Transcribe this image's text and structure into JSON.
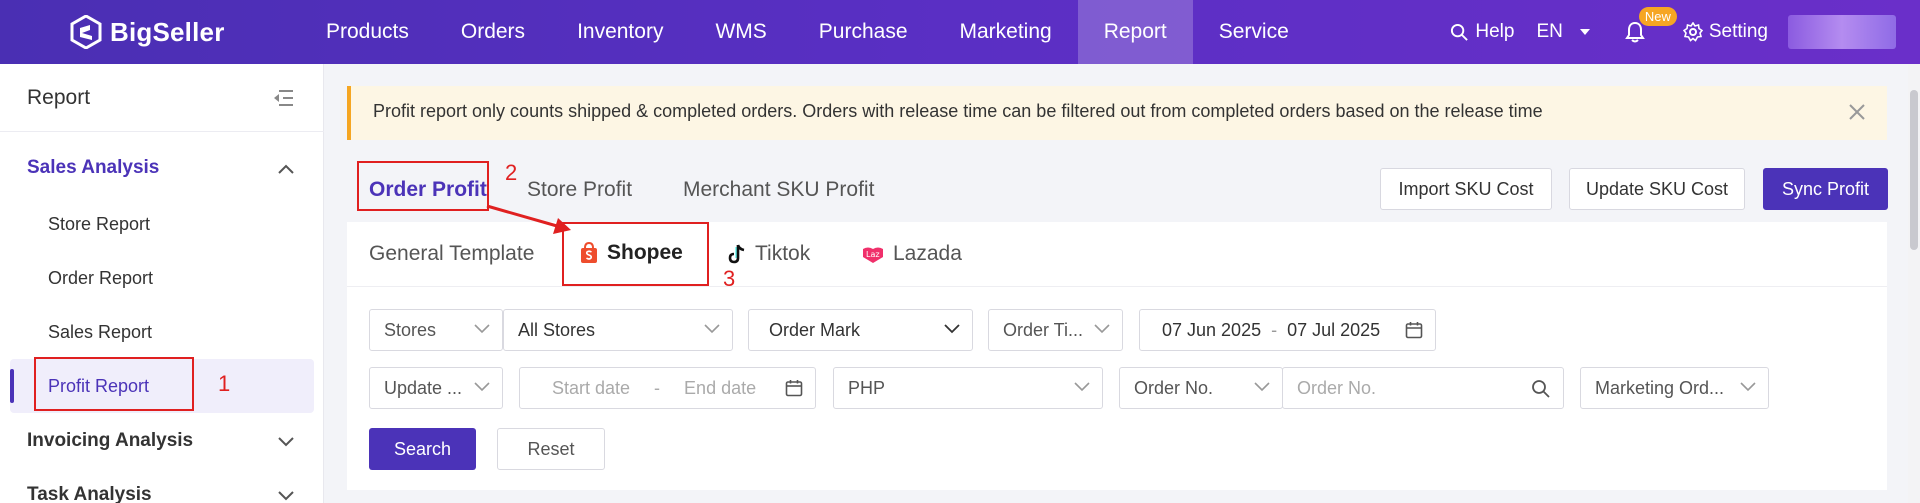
{
  "app": {
    "brand": "BigSeller",
    "nav": [
      "Products",
      "Orders",
      "Inventory",
      "WMS",
      "Purchase",
      "Marketing",
      "Report",
      "Service"
    ],
    "active_nav": "Report",
    "help": "Help",
    "language": "EN",
    "new_badge": "New",
    "setting": "Setting",
    "accent_color": "#4b33b8"
  },
  "sidebar": {
    "title": "Report",
    "groups": [
      {
        "label": "Sales Analysis",
        "open": true,
        "items": [
          "Store Report",
          "Order Report",
          "Sales Report",
          "Profit Report"
        ],
        "active_item": "Profit Report"
      },
      {
        "label": "Invoicing Analysis",
        "open": false
      },
      {
        "label": "Task Analysis",
        "open": false
      }
    ]
  },
  "notice": {
    "text": "Profit report only counts shipped & completed orders. Orders with release time can be filtered out from completed orders based on the release time"
  },
  "tabs": {
    "main": [
      "Order Profit",
      "Store Profit",
      "Merchant SKU Profit"
    ],
    "active": "Order Profit",
    "platforms": [
      "General Template",
      "Shopee",
      "Tiktok",
      "Lazada"
    ],
    "active_platform": "Shopee"
  },
  "actions": {
    "import_sku_cost": "Import SKU Cost",
    "update_sku_cost": "Update SKU Cost",
    "sync_profit": "Sync Profit"
  },
  "filters": {
    "stores_label": "Stores",
    "stores_value": "All Stores",
    "order_mark": "Order Mark",
    "order_time_label": "Order Ti...",
    "date_from": "07 Jun 2025",
    "date_to": "07 Jul 2025",
    "date_sep": "-",
    "update_label": "Update ...",
    "start_date_placeholder": "Start date",
    "end_date_placeholder": "End date",
    "currency": "PHP",
    "order_no_label": "Order No.",
    "order_no_placeholder": "Order No.",
    "marketing_order": "Marketing Ord...",
    "search": "Search",
    "reset": "Reset"
  },
  "annotations": [
    "1",
    "2",
    "3"
  ]
}
